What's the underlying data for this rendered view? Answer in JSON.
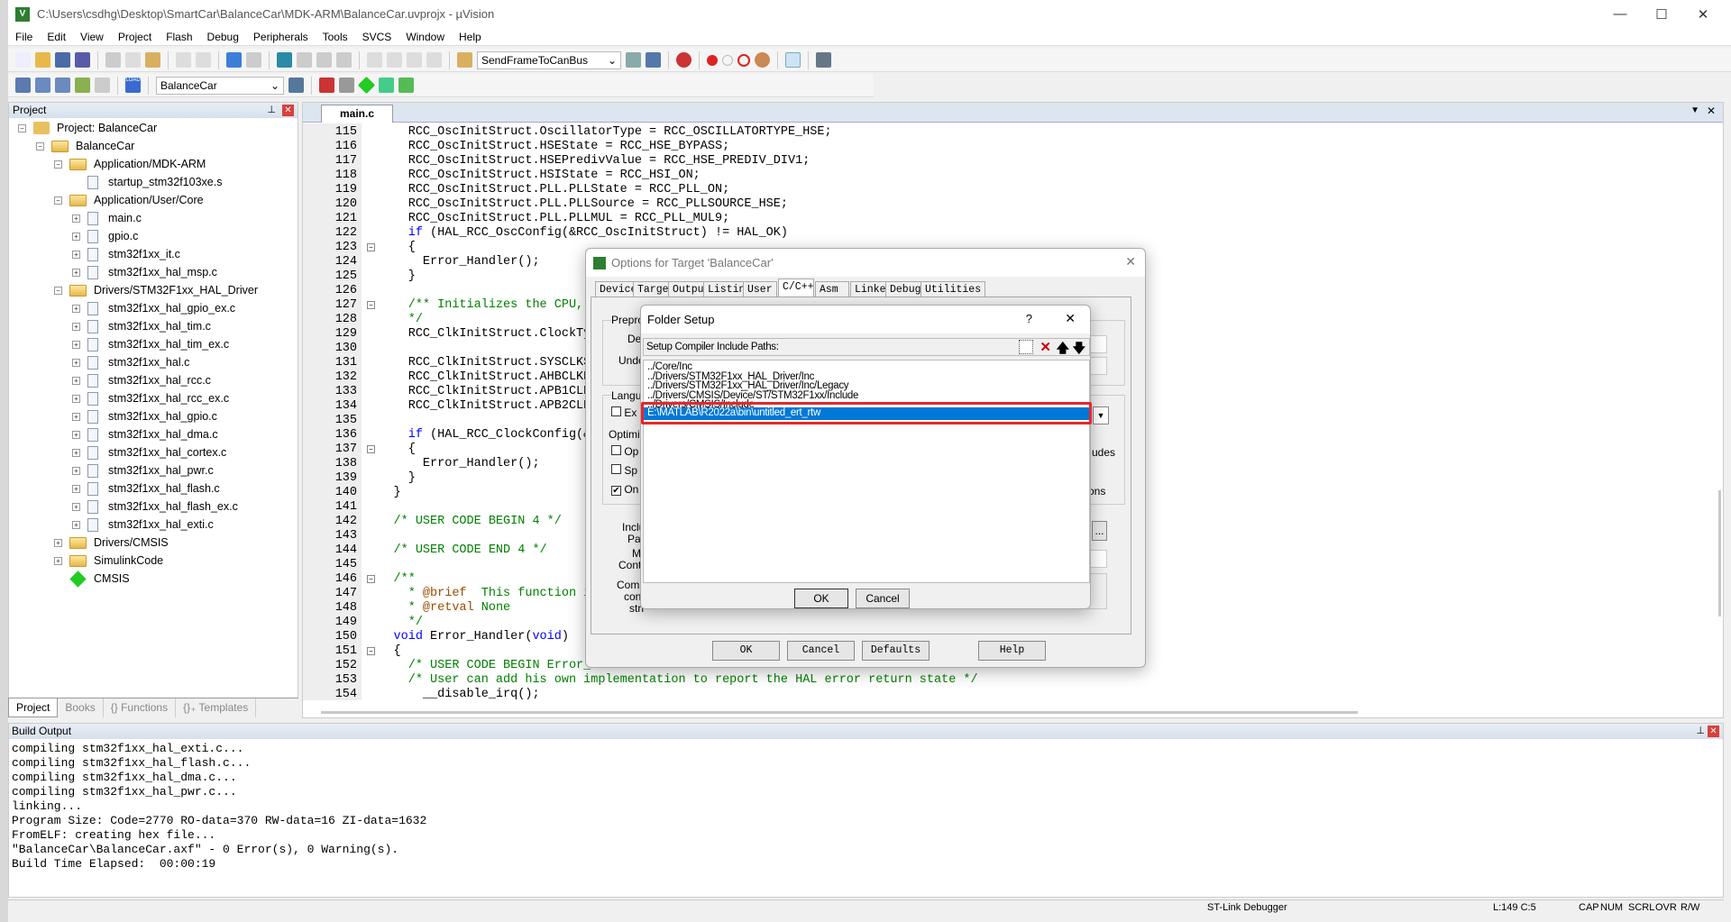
{
  "window": {
    "title": "C:\\Users\\csdhg\\Desktop\\SmartCar\\BalanceCar\\MDK-ARM\\BalanceCar.uvprojx - µVision",
    "minimize": "—",
    "maximize": "☐",
    "close": "✕"
  },
  "menu": [
    "File",
    "Edit",
    "View",
    "Project",
    "Flash",
    "Debug",
    "Peripherals",
    "Tools",
    "SVCS",
    "Window",
    "Help"
  ],
  "toolbar": {
    "find_combo": "SendFrameToCanBus",
    "target_combo": "BalanceCar",
    "load_label": "LOAD"
  },
  "project_panel": {
    "title": "Project",
    "tree": [
      {
        "label": "Project: BalanceCar",
        "level": 0,
        "type": "root",
        "exp": "−"
      },
      {
        "label": "BalanceCar",
        "level": 1,
        "type": "target",
        "exp": "−"
      },
      {
        "label": "Application/MDK-ARM",
        "level": 2,
        "type": "folder",
        "exp": "−"
      },
      {
        "label": "startup_stm32f103xe.s",
        "level": 3,
        "type": "file",
        "exp": ""
      },
      {
        "label": "Application/User/Core",
        "level": 2,
        "type": "folder",
        "exp": "−"
      },
      {
        "label": "main.c",
        "level": 3,
        "type": "file",
        "exp": "+"
      },
      {
        "label": "gpio.c",
        "level": 3,
        "type": "file",
        "exp": "+"
      },
      {
        "label": "stm32f1xx_it.c",
        "level": 3,
        "type": "file",
        "exp": "+"
      },
      {
        "label": "stm32f1xx_hal_msp.c",
        "level": 3,
        "type": "file",
        "exp": "+"
      },
      {
        "label": "Drivers/STM32F1xx_HAL_Driver",
        "level": 2,
        "type": "folder",
        "exp": "−"
      },
      {
        "label": "stm32f1xx_hal_gpio_ex.c",
        "level": 3,
        "type": "file",
        "exp": "+"
      },
      {
        "label": "stm32f1xx_hal_tim.c",
        "level": 3,
        "type": "file",
        "exp": "+"
      },
      {
        "label": "stm32f1xx_hal_tim_ex.c",
        "level": 3,
        "type": "file",
        "exp": "+"
      },
      {
        "label": "stm32f1xx_hal.c",
        "level": 3,
        "type": "file",
        "exp": "+"
      },
      {
        "label": "stm32f1xx_hal_rcc.c",
        "level": 3,
        "type": "file",
        "exp": "+"
      },
      {
        "label": "stm32f1xx_hal_rcc_ex.c",
        "level": 3,
        "type": "file",
        "exp": "+"
      },
      {
        "label": "stm32f1xx_hal_gpio.c",
        "level": 3,
        "type": "file",
        "exp": "+"
      },
      {
        "label": "stm32f1xx_hal_dma.c",
        "level": 3,
        "type": "file",
        "exp": "+"
      },
      {
        "label": "stm32f1xx_hal_cortex.c",
        "level": 3,
        "type": "file",
        "exp": "+"
      },
      {
        "label": "stm32f1xx_hal_pwr.c",
        "level": 3,
        "type": "file",
        "exp": "+"
      },
      {
        "label": "stm32f1xx_hal_flash.c",
        "level": 3,
        "type": "file",
        "exp": "+"
      },
      {
        "label": "stm32f1xx_hal_flash_ex.c",
        "level": 3,
        "type": "file",
        "exp": "+"
      },
      {
        "label": "stm32f1xx_hal_exti.c",
        "level": 3,
        "type": "file",
        "exp": "+"
      },
      {
        "label": "Drivers/CMSIS",
        "level": 2,
        "type": "folder",
        "exp": "+"
      },
      {
        "label": "SimulinkCode",
        "level": 2,
        "type": "folder",
        "exp": "+"
      },
      {
        "label": "CMSIS",
        "level": 2,
        "type": "component",
        "exp": ""
      }
    ],
    "tabs": [
      "Project",
      "Books",
      "{} Functions",
      "{}₊ Templates"
    ]
  },
  "editor": {
    "tab": "main.c",
    "lines": [
      {
        "n": "115",
        "segs": [
          [
            "",
            "  RCC_OscInitStruct.OscillatorType = RCC_OSCILLATORTYPE_HSE;"
          ]
        ]
      },
      {
        "n": "116",
        "segs": [
          [
            "",
            "  RCC_OscInitStruct.HSEState = RCC_HSE_BYPASS;"
          ]
        ]
      },
      {
        "n": "117",
        "segs": [
          [
            "",
            "  RCC_OscInitStruct.HSEPredivValue = RCC_HSE_PREDIV_DIV1;"
          ]
        ]
      },
      {
        "n": "118",
        "segs": [
          [
            "",
            "  RCC_OscInitStruct.HSIState = RCC_HSI_ON;"
          ]
        ]
      },
      {
        "n": "119",
        "segs": [
          [
            "",
            "  RCC_OscInitStruct.PLL.PLLState = RCC_PLL_ON;"
          ]
        ]
      },
      {
        "n": "120",
        "segs": [
          [
            "",
            "  RCC_OscInitStruct.PLL.PLLSource = RCC_PLLSOURCE_HSE;"
          ]
        ]
      },
      {
        "n": "121",
        "segs": [
          [
            "",
            "  RCC_OscInitStruct.PLL.PLLMUL = RCC_PLL_MUL9;"
          ]
        ]
      },
      {
        "n": "122",
        "segs": [
          [
            "kw",
            "  if"
          ],
          [
            "",
            " (HAL_RCC_OscConfig(&RCC_OscInitStruct) != HAL_OK)"
          ]
        ]
      },
      {
        "n": "123",
        "fold": "−",
        "segs": [
          [
            "",
            "  {"
          ]
        ]
      },
      {
        "n": "124",
        "segs": [
          [
            "",
            "    Error_Handler();"
          ]
        ]
      },
      {
        "n": "125",
        "segs": [
          [
            "",
            "  }"
          ]
        ]
      },
      {
        "n": "126",
        "segs": []
      },
      {
        "n": "127",
        "fold": "−",
        "segs": [
          [
            "cm",
            "  /** Initializes the CPU, AHB"
          ]
        ]
      },
      {
        "n": "128",
        "segs": [
          [
            "cm",
            "  */"
          ]
        ]
      },
      {
        "n": "129",
        "segs": [
          [
            "",
            "  RCC_ClkInitStruct.ClockType"
          ]
        ]
      },
      {
        "n": "130",
        "segs": []
      },
      {
        "n": "131",
        "segs": [
          [
            "",
            "  RCC_ClkInitStruct.SYSCLKSou"
          ]
        ]
      },
      {
        "n": "132",
        "segs": [
          [
            "",
            "  RCC_ClkInitStruct.AHBCLKDiv"
          ]
        ]
      },
      {
        "n": "133",
        "segs": [
          [
            "",
            "  RCC_ClkInitStruct.APB1CLKDi"
          ]
        ]
      },
      {
        "n": "134",
        "segs": [
          [
            "",
            "  RCC_ClkInitStruct.APB2CLKDi"
          ]
        ]
      },
      {
        "n": "135",
        "segs": []
      },
      {
        "n": "136",
        "segs": [
          [
            "kw",
            "  if"
          ],
          [
            "",
            " (HAL_RCC_ClockConfig(&RC"
          ]
        ]
      },
      {
        "n": "137",
        "fold": "−",
        "segs": [
          [
            "",
            "  {"
          ]
        ]
      },
      {
        "n": "138",
        "segs": [
          [
            "",
            "    Error_Handler();"
          ]
        ]
      },
      {
        "n": "139",
        "segs": [
          [
            "",
            "  }"
          ]
        ]
      },
      {
        "n": "140",
        "segs": [
          [
            "",
            "}"
          ]
        ]
      },
      {
        "n": "141",
        "segs": []
      },
      {
        "n": "142",
        "segs": [
          [
            "cm",
            "/* USER CODE BEGIN 4 */"
          ]
        ]
      },
      {
        "n": "143",
        "segs": []
      },
      {
        "n": "144",
        "segs": [
          [
            "cm",
            "/* USER CODE END 4 */"
          ]
        ]
      },
      {
        "n": "145",
        "segs": []
      },
      {
        "n": "146",
        "fold": "−",
        "segs": [
          [
            "cm",
            "/**"
          ]
        ]
      },
      {
        "n": "147",
        "segs": [
          [
            "cm",
            "  * "
          ],
          [
            "dk",
            "@brief"
          ],
          [
            "cm",
            "  This function is"
          ]
        ]
      },
      {
        "n": "148",
        "segs": [
          [
            "cm",
            "  * "
          ],
          [
            "dk",
            "@retval"
          ],
          [
            "cm",
            " None"
          ]
        ]
      },
      {
        "n": "149",
        "segs": [
          [
            "cm",
            "  */"
          ]
        ]
      },
      {
        "n": "150",
        "segs": [
          [
            "kw",
            "void"
          ],
          [
            "",
            " Error_Handler("
          ],
          [
            "kw",
            "void"
          ],
          [
            "",
            ")"
          ]
        ]
      },
      {
        "n": "151",
        "fold": "−",
        "segs": [
          [
            "",
            "{"
          ]
        ]
      },
      {
        "n": "152",
        "segs": [
          [
            "cm",
            "  /* USER CODE BEGIN Error_Ha"
          ]
        ]
      },
      {
        "n": "153",
        "segs": [
          [
            "cm",
            "  /* User can add his own implementation to report the HAL error return state */"
          ]
        ]
      },
      {
        "n": "154",
        "segs": [
          [
            "",
            "    __disable_irq();"
          ]
        ]
      }
    ]
  },
  "options_dialog": {
    "title": "Options for Target 'BalanceCar'",
    "tabs": [
      "Device",
      "Target",
      "Output",
      "Listing",
      "User",
      "C/C++",
      "Asm",
      "Linker",
      "Debug",
      "Utilities"
    ],
    "active_tab": "C/C++",
    "fragments": {
      "prepro": "Prepro",
      "def": "Def",
      "undef": "Undef",
      "langu": "Langu",
      "ex": "Ex",
      "optimi": "Optimi",
      "op": "Op",
      "sp": "Sp",
      "on": "On",
      "inclu": "Inclu",
      "pat": "Pat",
      "m": "M",
      "contr": "Contr",
      "comp": "Comp",
      "cont": "cont",
      "stri": "stri",
      "udes": "udes",
      "ons": "ons",
      "browse": "..."
    },
    "buttons": {
      "ok": "OK",
      "cancel": "Cancel",
      "defaults": "Defaults",
      "help": "Help"
    }
  },
  "folder_setup": {
    "title": "Folder Setup",
    "help": "?",
    "close": "✕",
    "label": "Setup Compiler Include Paths:",
    "paths": [
      "../Core/Inc",
      "../Drivers/STM32F1xx_HAL_Driver/Inc",
      "../Drivers/STM32F1xx_HAL_Driver/Inc/Legacy",
      "../Drivers/CMSIS/Device/ST/STM32F1xx/Include",
      "../Drivers/CMSIS/Include",
      "E:\\MATLAB\\R2022a\\bin\\untitled_ert_rtw"
    ],
    "selected_index": 5,
    "highlight_color": "#e8262a",
    "selection_color": "#0078d7",
    "ok": "OK",
    "cancel": "Cancel"
  },
  "build_output": {
    "title": "Build Output",
    "lines": [
      "compiling stm32f1xx_hal_exti.c...",
      "compiling stm32f1xx_hal_flash.c...",
      "compiling stm32f1xx_hal_dma.c...",
      "compiling stm32f1xx_hal_pwr.c...",
      "linking...",
      "Program Size: Code=2770 RO-data=370 RW-data=16 ZI-data=1632",
      "FromELF: creating hex file...",
      "\"BalanceCar\\BalanceCar.axf\" - 0 Error(s), 0 Warning(s).",
      "Build Time Elapsed:  00:00:19"
    ]
  },
  "status_bar": {
    "debugger": "ST-Link Debugger",
    "position": "L:149 C:5",
    "cap": "CAP",
    "num": "NUM",
    "scrl": "SCRL",
    "ovr": "OVR",
    "rw": "R/W"
  }
}
